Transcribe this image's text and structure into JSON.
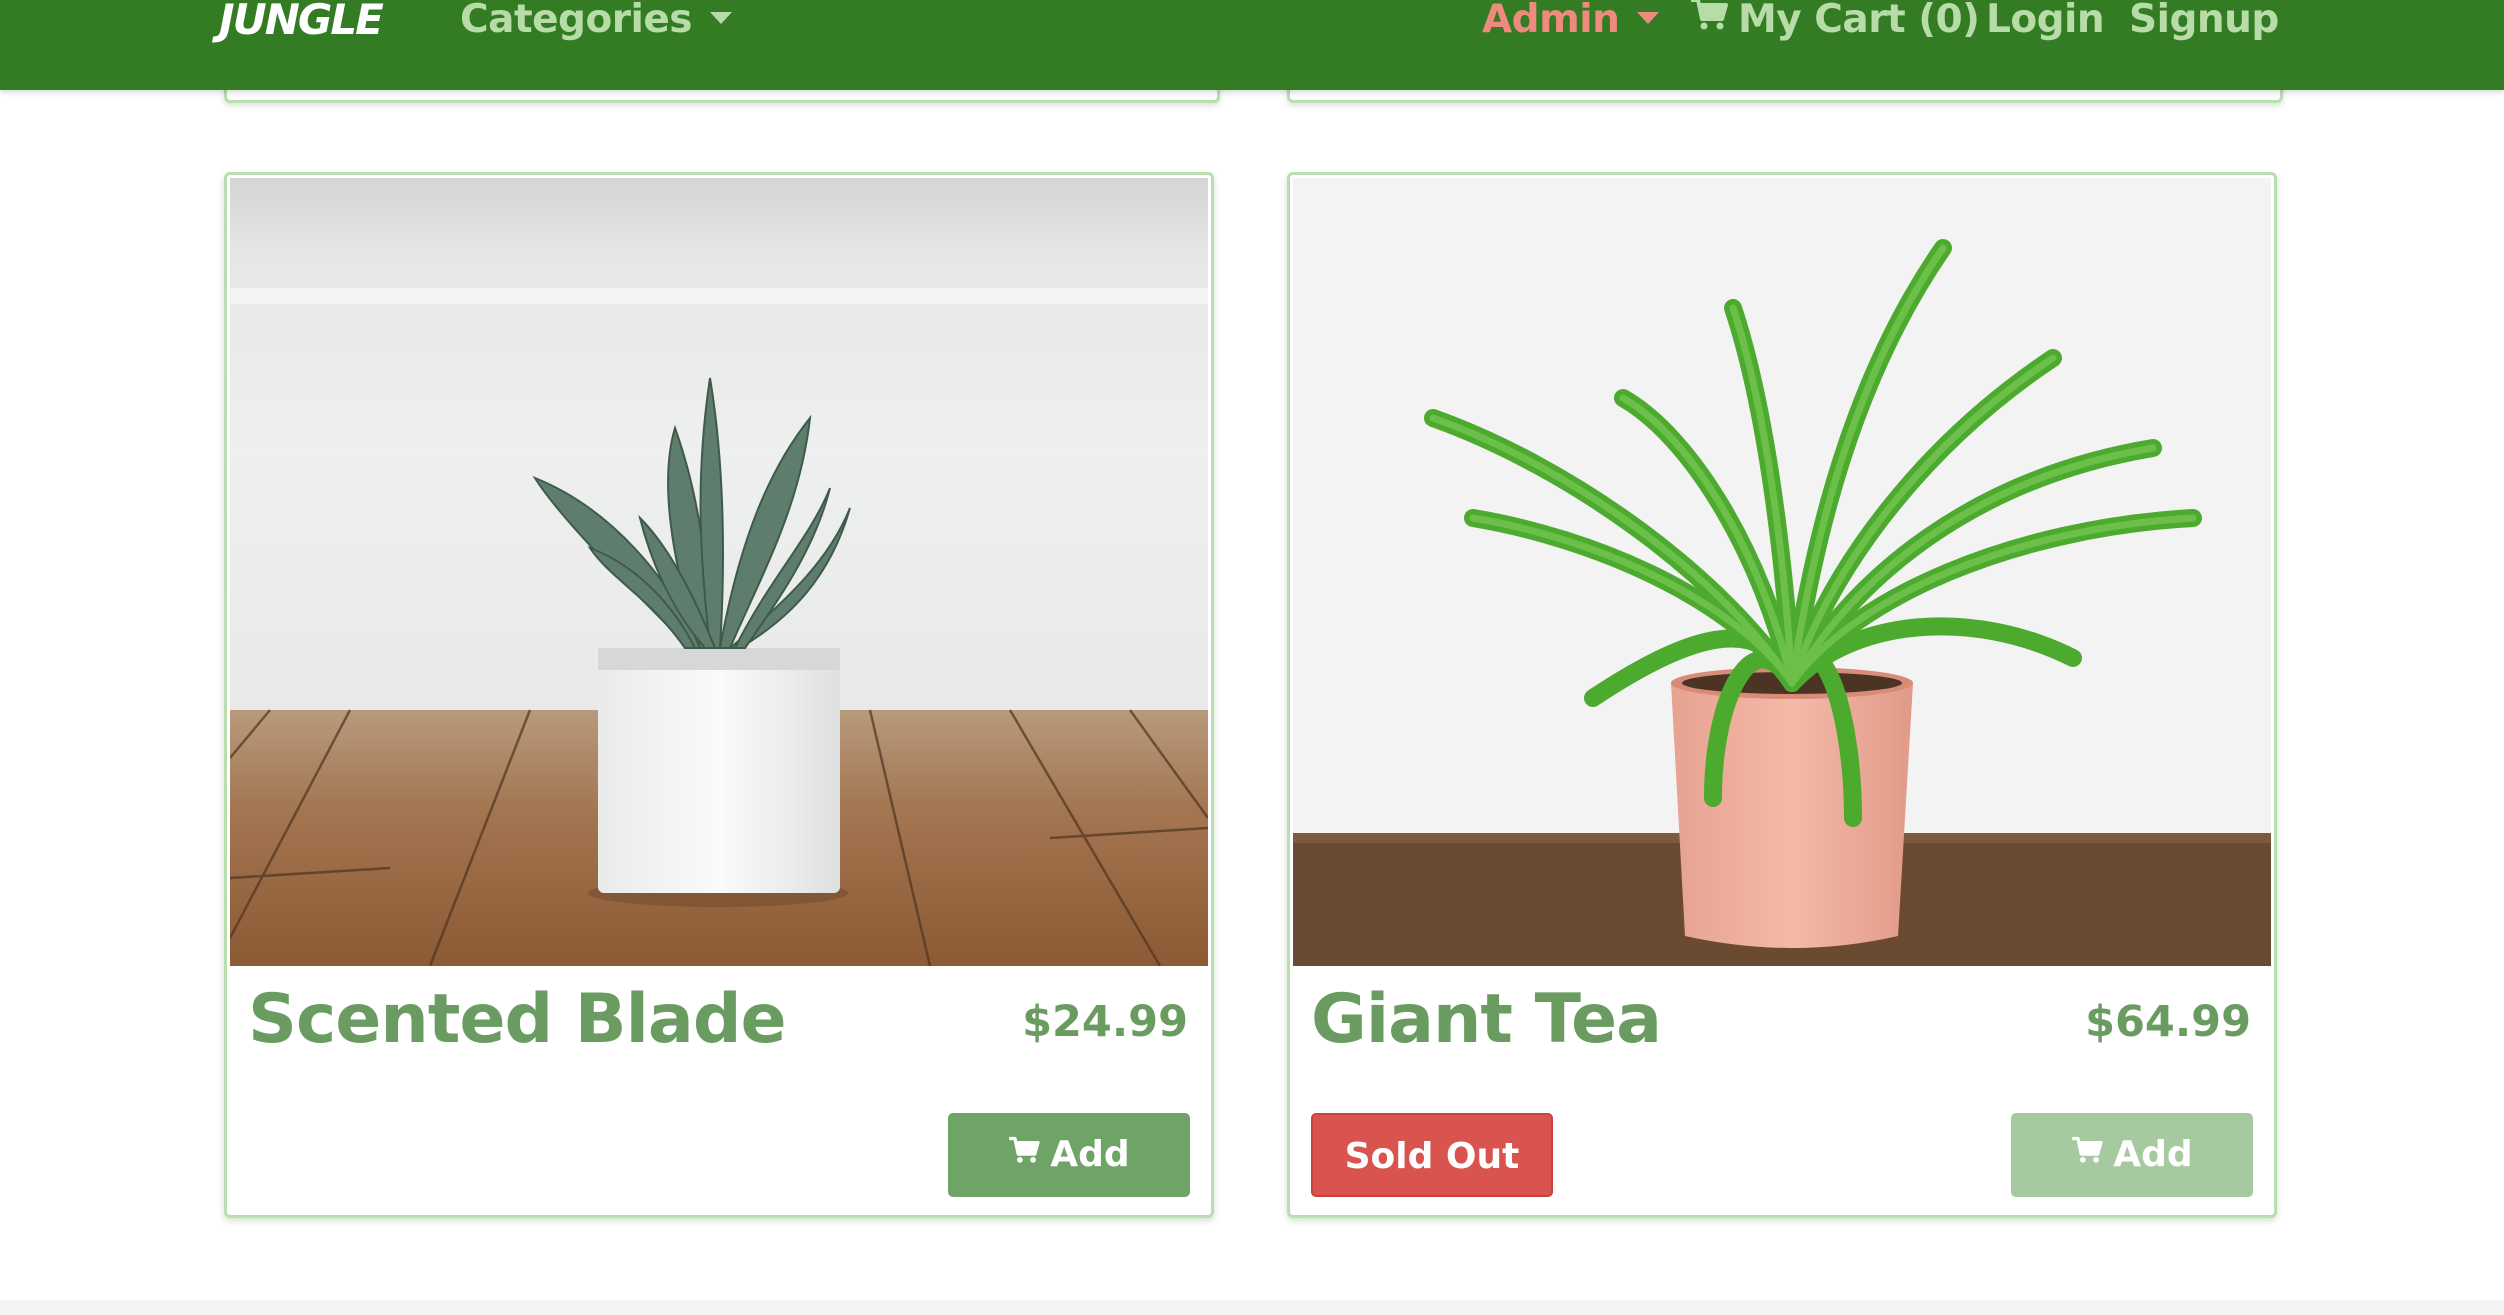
{
  "nav": {
    "brand": "JUNGLE",
    "categories": "Categories",
    "admin": "Admin",
    "cart": "My Cart (0)",
    "login": "Login",
    "signup": "Signup"
  },
  "products": [
    {
      "name": "Scented Blade",
      "price": "$24.99",
      "add_label": "Add",
      "sold_out": false
    },
    {
      "name": "Giant Tea",
      "price": "$64.99",
      "add_label": "Add",
      "sold_out_label": "Sold Out",
      "sold_out": true
    }
  ],
  "colors": {
    "navbar": "#347c24",
    "accent_green": "#6ea466",
    "admin_pink": "#ef8a7f",
    "sold_out_red": "#d9534f"
  },
  "icons": {
    "cart": "shopping-cart-icon",
    "caret": "chevron-down-icon"
  }
}
